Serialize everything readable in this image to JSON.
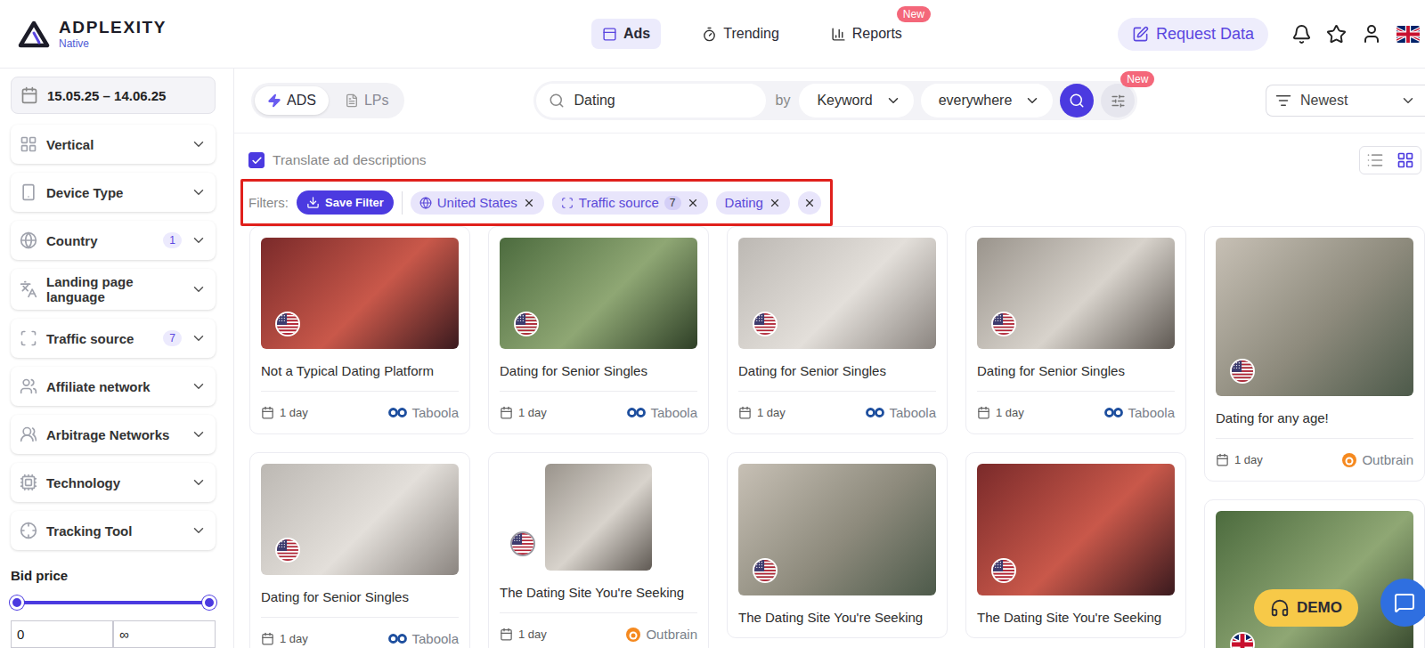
{
  "header": {
    "logo": {
      "name": "ADPLEXITY",
      "tagline": "Native"
    },
    "nav": [
      {
        "label": "Ads",
        "selected": true,
        "kind": "ads"
      },
      {
        "label": "Trending",
        "selected": false,
        "kind": "trending"
      },
      {
        "label": "Reports",
        "selected": false,
        "kind": "reports",
        "badge": "New"
      }
    ],
    "request_button": "Request Data"
  },
  "sidebar": {
    "date_range": "15.05.25 – 14.06.25",
    "filters": [
      {
        "label": "Vertical",
        "kind": "vertical"
      },
      {
        "label": "Device Type",
        "kind": "device"
      },
      {
        "label": "Country",
        "count": "1",
        "kind": "country"
      },
      {
        "label": "Landing page language",
        "kind": "language"
      },
      {
        "label": "Traffic source",
        "count": "7",
        "kind": "source"
      },
      {
        "label": "Affiliate network",
        "kind": "affiliate"
      },
      {
        "label": "Arbitrage Networks",
        "kind": "arbitrage"
      },
      {
        "label": "Technology",
        "kind": "technology"
      },
      {
        "label": "Tracking Tool",
        "kind": "tracking"
      }
    ],
    "bid_price": {
      "label": "Bid price",
      "min": "0",
      "max": "∞",
      "level_low": 0,
      "level_high": 1
    }
  },
  "toolbar": {
    "tabs": [
      {
        "label": "ADS",
        "selected": true,
        "kind": "ads"
      },
      {
        "label": "LPs",
        "selected": false,
        "kind": "lps"
      }
    ],
    "search": {
      "value": "Dating"
    },
    "by_label": "by",
    "search_by": "Keyword",
    "scope": "everywhere",
    "settings_badge": "New",
    "sort": "Newest"
  },
  "options": {
    "translate": {
      "label": "Translate ad descriptions",
      "checked": true
    },
    "views": [
      {
        "kind": "list",
        "selected": false
      },
      {
        "kind": "grid",
        "selected": true
      }
    ]
  },
  "filters": {
    "label": "Filters:",
    "save_button": "Save Filter",
    "highlighted": true,
    "chips": [
      {
        "label": "United States",
        "kind": "country"
      },
      {
        "label": "Traffic source",
        "count": "7",
        "kind": "source"
      },
      {
        "label": "Dating",
        "kind": "keyword"
      }
    ]
  },
  "columns": [
    {
      "cards": [
        {
          "title": "Not a Typical Dating Platform",
          "age": "1 day",
          "source": "Taboola",
          "flag": "us",
          "kind": "landscape"
        },
        {
          "title": "Dating for Senior Singles",
          "age": "1 day",
          "source": "Taboola",
          "flag": "us",
          "kind": "landscape"
        }
      ]
    },
    {
      "cards": [
        {
          "title": "Dating for Senior Singles",
          "age": "1 day",
          "source": "Taboola",
          "flag": "us",
          "kind": "landscape"
        },
        {
          "title": "The Dating Site You're Seeking",
          "age": "1 day",
          "source": "Outbrain",
          "flag": "us",
          "kind": "narrow"
        }
      ]
    },
    {
      "cards": [
        {
          "title": "Dating for Senior Singles",
          "age": "1 day",
          "source": "Taboola",
          "flag": "us",
          "kind": "landscape"
        },
        {
          "title": "The Dating Site You're Seeking",
          "flag": "us",
          "kind": "portrait"
        }
      ]
    },
    {
      "cards": [
        {
          "title": "Dating for Senior Singles",
          "age": "1 day",
          "source": "Taboola",
          "flag": "us",
          "kind": "landscape"
        },
        {
          "title": "The Dating Site You're Seeking",
          "flag": "us",
          "kind": "portrait"
        }
      ]
    },
    {
      "cards": [
        {
          "title": "Dating for any age!",
          "age": "1 day",
          "source": "Outbrain",
          "flag": "us",
          "kind": "tall"
        },
        {
          "flag": "uk",
          "kind": "tall"
        }
      ]
    }
  ],
  "demo_button": "DEMO"
}
